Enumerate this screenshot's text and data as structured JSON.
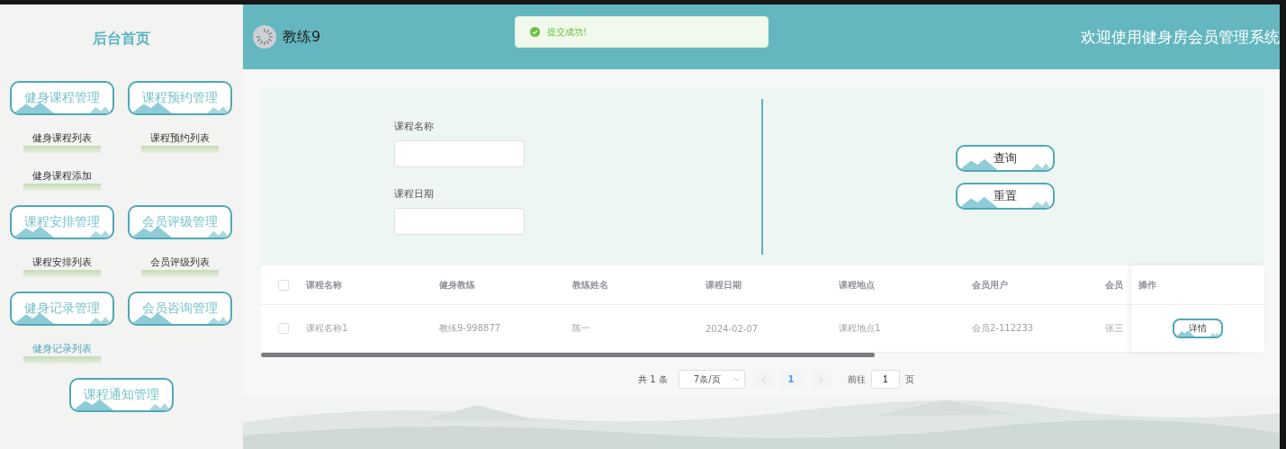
{
  "sidebar": {
    "title": "后台首页",
    "menus": [
      {
        "label": "健身课程管理",
        "children": [
          {
            "label": "健身课程列表",
            "selected": false
          },
          {
            "label": "健身课程添加",
            "selected": false
          }
        ]
      },
      {
        "label": "课程预约管理",
        "children": [
          {
            "label": "课程预约列表",
            "selected": false
          }
        ]
      },
      {
        "label": "课程安排管理",
        "children": [
          {
            "label": "课程安排列表",
            "selected": false
          }
        ]
      },
      {
        "label": "会员评级管理",
        "children": [
          {
            "label": "会员评级列表",
            "selected": false
          }
        ]
      },
      {
        "label": "健身记录管理",
        "children": [
          {
            "label": "健身记录列表",
            "selected": true
          }
        ]
      },
      {
        "label": "会员咨询管理"
      },
      {
        "label": "课程通知管理"
      }
    ]
  },
  "header": {
    "username": "教练9",
    "system_title": "欢迎使用健身房会员管理系统"
  },
  "toast": {
    "kind": "success",
    "message": "提交成功!"
  },
  "search": {
    "fields": [
      {
        "label": "课程名称"
      },
      {
        "label": "课程日期"
      }
    ],
    "buttons": [
      "查询",
      "重置"
    ]
  },
  "table": {
    "all_checked": false,
    "columns": [
      "课程名称",
      "健身教练",
      "教练姓名",
      "课程日期",
      "课程地点",
      "会员用户",
      "会员"
    ],
    "rows": [
      {
        "checked": false,
        "cells": [
          "课程名称1",
          "教练9-998877",
          "陈一",
          "2024-02-07",
          "课程地点1",
          "会员2-112233",
          "张三"
        ],
        "actions": [
          "详情"
        ]
      }
    ],
    "action_column": "操作"
  },
  "pagination": {
    "total": "共 1 条",
    "page_size": "7条/页",
    "pages": [
      {
        "label": "1",
        "selected": true
      }
    ],
    "goto_label": "前往",
    "goto_value": "1",
    "page_suffix": "页"
  }
}
